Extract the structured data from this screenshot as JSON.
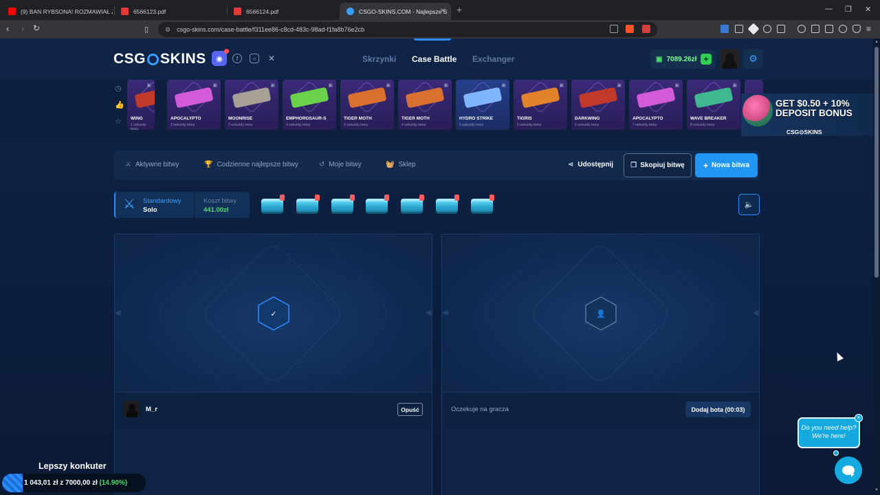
{
  "browser": {
    "tabs": [
      {
        "title": "(9) BAN RYBSONA! ROZMAWIAŁ Z D",
        "icon": "youtube-icon",
        "color": "#ff0000"
      },
      {
        "title": "6566123.pdf",
        "icon": "pdf-icon",
        "color": "#e53935"
      },
      {
        "title": "6566124.pdf",
        "icon": "pdf-icon",
        "color": "#e53935"
      },
      {
        "title": "CSGO-SKINS.COM - Najlepsze S",
        "icon": "csgo-skins-icon",
        "color": "#3aa0ff"
      }
    ],
    "url": "csgo-skins.com/case-battle/f311ee86-c8cd-483c-98ad-f1fa8b76e2cb"
  },
  "header": {
    "logo_left": "CSG",
    "logo_right": "SKINS",
    "nav": [
      "Skrzynki",
      "Case Battle",
      "Exchanger"
    ],
    "balance": "7089.26zł"
  },
  "drops": [
    {
      "name": "WING",
      "time": "1 sekundy temu",
      "style": "purple",
      "weapon_color": "#c0392b"
    },
    {
      "name": "APOCALYPTO",
      "time": "3 sekundy temu",
      "style": "purple",
      "weapon_color": "#d35ad8"
    },
    {
      "name": "MOONRISE",
      "time": "2 sekundy temu",
      "style": "purple",
      "weapon_color": "#a89f96"
    },
    {
      "name": "EMPHOROSAUR-S",
      "time": "4 sekundy temu",
      "style": "purple",
      "weapon_color": "#6bd14b"
    },
    {
      "name": "TIGER MOTH",
      "time": "4 sekundy temu",
      "style": "purple",
      "weapon_color": "#d9702f"
    },
    {
      "name": "TIGER MOTH",
      "time": "4 sekundy temu",
      "style": "purple",
      "weapon_color": "#d9702f"
    },
    {
      "name": "HYDRO STRIKE",
      "time": "5 sekundy temu",
      "style": "blue",
      "weapon_color": "#7fb6ff"
    },
    {
      "name": "TIGRIS",
      "time": "5 sekundy temu",
      "style": "purple",
      "weapon_color": "#e0832b"
    },
    {
      "name": "DARKWING",
      "time": "6 sekundy temu",
      "style": "purple",
      "weapon_color": "#c0392b"
    },
    {
      "name": "APOCALYPTO",
      "time": "7 sekundy temu",
      "style": "purple",
      "weapon_color": "#d35ad8"
    },
    {
      "name": "WAVE BREAKER",
      "time": "8 sekundy temu",
      "style": "purple",
      "weapon_color": "#3fb890"
    }
  ],
  "promo": {
    "line1": "GET $0.50 + 10%",
    "line2": "DEPOSIT BONUS",
    "logo": "CSG⊙SKINS"
  },
  "battle_bar": {
    "items": [
      "Aktywne bitwy",
      "Codzienne najlepsze bitwy",
      "Moje bitwy",
      "Sklep"
    ],
    "share": "Udostępnij",
    "copy": "Skopiuj bitwę",
    "new": "Nowa bitwa"
  },
  "battle": {
    "mode_label": "Standardowy",
    "mode_value": "Solo",
    "cost_label": "Koszt bitwy",
    "cost_value": "441.00zł",
    "case_count": 7
  },
  "slots": [
    {
      "player": "M_r",
      "button": "Opuść",
      "state": "ready"
    },
    {
      "status": "Oczekuje na gracza",
      "button": "Dodaj bota (00:03)",
      "state": "waiting"
    }
  ],
  "konkurs": {
    "title": "Lepszy konkuter",
    "progress": "1 043,01 zł z 7000,00 zł",
    "percent": "(14.90%)"
  },
  "help": {
    "line1": "Do you need help?",
    "line2": "We're here!"
  }
}
